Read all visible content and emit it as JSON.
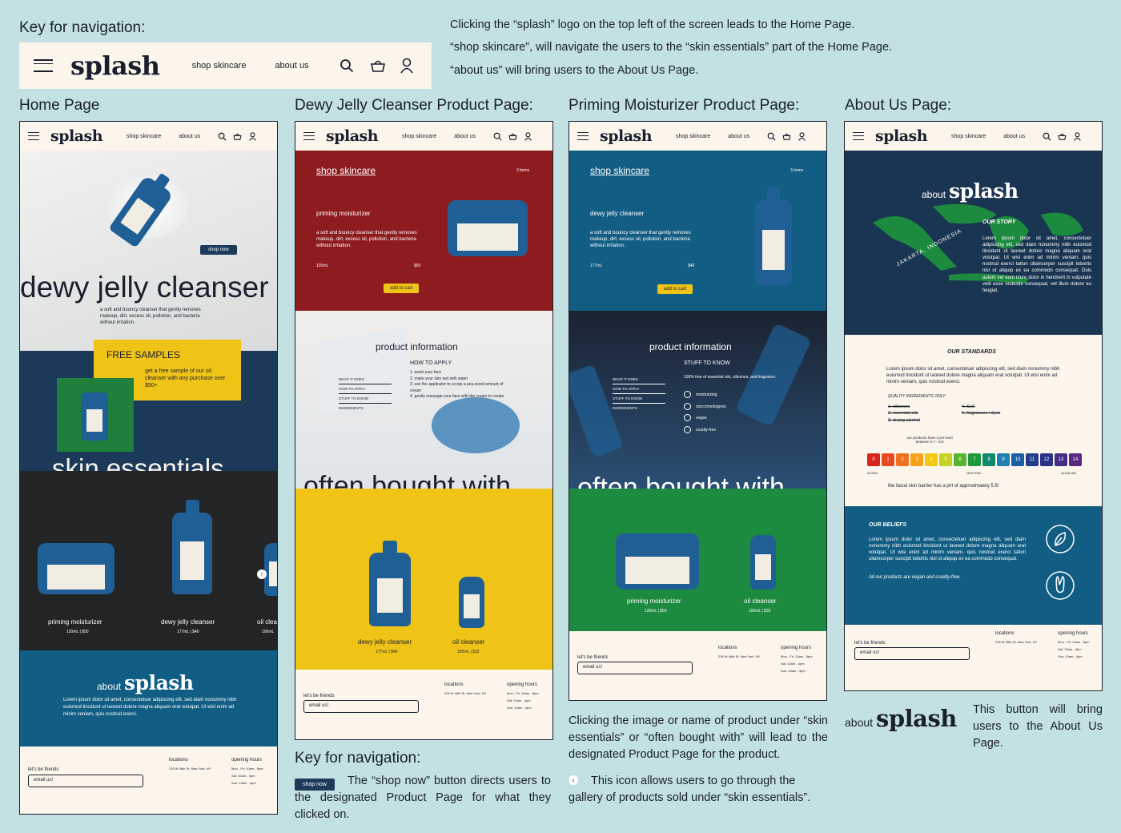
{
  "header": {
    "key_title": "Key for navigation:",
    "notes": [
      "Clicking the “splash” logo on the top left of the screen leads to the Home Page.",
      "“shop skincare”, will navigate the users to the “skin essentials” part of the Home Page.",
      "“about us” will bring users to the About Us Page."
    ]
  },
  "nav": {
    "logo": "splash",
    "shop": "shop skincare",
    "about": "about us"
  },
  "sections": {
    "home": "Home Page",
    "dewy": "Dewy Jelly Cleanser Product Page:",
    "priming": "Priming Moisturizer Product Page:",
    "about": "About Us Page:"
  },
  "home": {
    "shop_now": "shop now",
    "hero": "dewy jelly cleanser",
    "hero_desc": "a soft and bouncy cleanser that gently removes makeup, dirt, excess oil, pollution, and bacteria without irritation.",
    "samples_title": "FREE SAMPLES",
    "samples_desc": "get a free sample of our oil cleanser with any purchase over $50+",
    "essentials": "skin essentials",
    "products": [
      {
        "name": "priming moisturizer",
        "meta": "120mL  |  $50"
      },
      {
        "name": "dewy jelly cleanser",
        "meta": "177mL  |  $40"
      },
      {
        "name": "oil clea",
        "meta": "100mL"
      }
    ],
    "about_word": "about",
    "about_body": "Lorem ipsum dolor sit amet, consectetuer adipiscing elit, sed diam nonummy nibh euismod tincidunt ut laoreet dolore magna aliquam erat volutpat. Ut wisi enim ad minim veniam, quis nostrud exerci."
  },
  "footer": {
    "friends": "let's be friends",
    "email": "email us!",
    "locations": "locations",
    "address": "226 W 46th St, New York, NY",
    "hours_title": "opening hours",
    "hours": [
      "Mon - Fri: 10am - 8pm",
      "Sat: 10am - 4pm",
      "Sun: 10am - 4pm"
    ]
  },
  "dewy": {
    "shop": "shop skincare",
    "items": "3 items",
    "title": "priming moisturizer",
    "desc": "a soft and bouncy cleanser that gently removes makeup, dirt, excess oil, pollution, and bacteria without irritation.",
    "size": "120mL",
    "price": "$50",
    "add": "add to cart",
    "info": "product information",
    "how": "HOW TO APPLY",
    "steps": [
      "1. wash your face",
      "2. make your skin wet with water",
      "3. use the applicator to scoop a pea-sized amount of cream",
      "4. gently massage your face with the cream to create"
    ],
    "menu": [
      "WHAT IT DOES",
      "HOW TO APPLY",
      "STUFF TO KNOW",
      "INGREDIENTS"
    ],
    "often": "often bought with",
    "products": [
      {
        "name": "dewy jelly cleanser",
        "meta": "177mL  |  $40"
      },
      {
        "name": "oil cleanser",
        "meta": "100mL  |  $32"
      }
    ]
  },
  "priming": {
    "shop": "shop skincare",
    "items": "3 items",
    "title": "dewy jelly cleanser",
    "desc": "a soft and bouncy cleanser that gently removes makeup, dirt, excess oil, pollution, and bacteria without irritation.",
    "size": "177mL",
    "price": "$40",
    "add": "add to cart",
    "info": "product information",
    "stuff": "STUFF TO KNOW",
    "free": "100% free of essential oils, silicones, and fragrance.",
    "tags": [
      "moisturizing",
      "noncomedogenic",
      "vegan",
      "cruelty-free"
    ],
    "menu": [
      "WHAT IT DOES",
      "HOW TO APPLY",
      "STUFF TO KNOW",
      "INGREDIENTS"
    ],
    "often": "often bought with",
    "products": [
      {
        "name": "priming moisturizer",
        "meta": "120mL  |  $50"
      },
      {
        "name": "oil cleanser",
        "meta": "100mL  |  $32"
      }
    ]
  },
  "aboutpage": {
    "about_word": "about",
    "story_title": "OUR STORY",
    "story": "Lorem ipsum dolor sit amet, consectetuer adipiscing elit, sed diam nonummy nibh euismod tincidunt ut laoreet dolore magna aliquam erat volutpat. Ut wisi enim ad minim veniam, quis nostrud exerci tation ullamcorper suscipit lobortis nisl ut aliquip ex ea commodo consequat. Duis autem vel eum iriure dolor in hendrerit in vulputate velit esse molestie consequat, vel illum dolore eu feugiat.",
    "map_label": "JAKARTA, INDONESIA",
    "standards_title": "OUR STANDARDS",
    "standards": "Lorem ipsum dolor sit amet, consectetuer adipiscing elit, sed diam nonummy nibh euismod tincidunt ut laoreet dolore magna aliquam erat volutpat. Ut wisi enim ad minim veniam, quis nostrud exerci.",
    "quality": "QUALITY INGREDIENTS ONLY:",
    "ingredients": [
      "1. silicones",
      "2. essential oils",
      "3. drying alcohol",
      "4. SLS",
      "5. fragrances / dyes"
    ],
    "ph_note": "our products have a pH level between 2.7 - 6.5",
    "ph_values": [
      "0",
      "1",
      "2",
      "3",
      "4",
      "5",
      "6",
      "7",
      "8",
      "9",
      "10",
      "11",
      "12",
      "13",
      "14"
    ],
    "ph_colors": [
      "#d7261e",
      "#e8491d",
      "#f26f21",
      "#f7a21b",
      "#f5c814",
      "#c7d321",
      "#58b531",
      "#1e9a3c",
      "#0f8a6b",
      "#1f7fb2",
      "#1c5ea5",
      "#243e8f",
      "#2c3285",
      "#452c84",
      "#5a2a81"
    ],
    "ph_labels": [
      "ACIDIC",
      "NEUTRAL",
      "ALKALINE"
    ],
    "ph_caption": "the facial skin barrier has a pH of approximately 5.5!",
    "beliefs_title": "OUR BELIEFS",
    "beliefs": "Lorem ipsum dolor sit amet, consectetuer adipiscing elit, sed diam nonummy nibh euismod tincidunt ut laoreet dolore magna aliquam erat volutpat. Ut wisi enim ad minim veniam, quis nostrud exerci tation ullamcorper suscipit lobortis nisl ut aliquip ex ea commodo consequat.",
    "beliefs2": "All our products are vegan and cruelty-free."
  },
  "bottom": {
    "key_title": "Key for navigation:",
    "shop_now": "shop now",
    "shop_note": "The “shop now” button directs users to the designated Product Page for what they clicked on.",
    "product_note": "Clicking the image or name of product under “skin essentials” or “often bought with” will lead to the designated Product Page for the product.",
    "arrow_note": "This icon allows users to go through the gallery of products sold under “skin essentials”.",
    "about_word": "about",
    "about_note": "This button will bring users to the About Us Page."
  }
}
